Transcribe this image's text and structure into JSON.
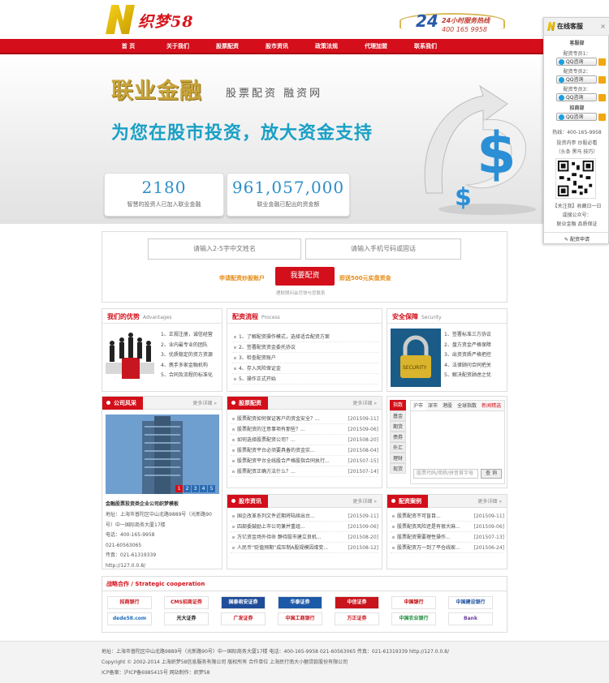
{
  "header": {
    "logo_text": "织梦58",
    "hotline_big": "24",
    "hotline_line1": "24小时服务热线",
    "hotline_line2": "400 165 9958"
  },
  "nav": [
    "首 页",
    "关于我们",
    "股票配资",
    "股市资讯",
    "政策法规",
    "代理加盟",
    "联系我们"
  ],
  "banner": {
    "brand": "联业金融",
    "tagline": "股票配资 融资网",
    "slogan": "为您在股市投资，放大资金支持",
    "stat1_num": "2180",
    "stat1_label": "智慧的投资人已加入联业金融",
    "stat2_num": "961,057,000",
    "stat2_label": "联业金融已配出的资金额"
  },
  "form": {
    "name_placeholder": "请输入2-5字中文姓名",
    "phone_placeholder": "请输入手机号码或固话",
    "left_text": "申请配资炒股账户",
    "button": "我要配资",
    "right_text": "即送500元实盘资金",
    "note": "理财顾问会尽快与您联系"
  },
  "advantages": {
    "title": "我们的优势",
    "en": "Advantages",
    "items": [
      "1、正规注册，诚信经营",
      "2、业内最专业的团队",
      "3、优质稳定的资方资源",
      "4、携手多家金融机构",
      "5、合同及流程的标准化"
    ]
  },
  "process": {
    "title": "配资流程",
    "en": "Process",
    "items": [
      "1、了解配资操作模式，选择适合配资方案",
      "2、签署配资资金委托协议",
      "3、检查配资账户",
      "4、存入风险保证金",
      "5、操作正式开始"
    ]
  },
  "security": {
    "title": "安全保障",
    "en": "Security",
    "items": [
      "1、签署标准三方协议",
      "2、盘方资金严格保障",
      "3、出资资质严格把控",
      "4、法律顾问合同把关",
      "5、解决配资顾虑之忧"
    ]
  },
  "company": {
    "title": "公司风采",
    "more": "更多详细 »",
    "pager": [
      "1",
      "2",
      "3",
      "4",
      "5"
    ],
    "name": "金融股票投资类企业公司织梦模板",
    "lines": [
      "地址：上海市普陀区中山北路9889号（光新路90",
      "号）中一国际商务大厦17楼",
      "电话：400-165-9958",
      "021-60563065",
      "传真：021-61319339",
      "http://127.0.0.8/"
    ]
  },
  "stock_finance": {
    "title": "股票配资",
    "more": "更多详细 »",
    "items": [
      {
        "t": "股票配资如何保证客户的资金安全？...",
        "d": "[201509-11]"
      },
      {
        "t": "股票配资的注意事项有那些？...",
        "d": "[201509-06]"
      },
      {
        "t": "如何选择股票配资公司？...",
        "d": "[201508-20]"
      },
      {
        "t": "股票配资平台必须要具备的资金实...",
        "d": "[201508-04]"
      },
      {
        "t": "股票配资平台全线股合严格股指合同执行...",
        "d": "[201507-15]"
      },
      {
        "t": "股票配资正确方法什么？...",
        "d": "[201507-14]"
      }
    ]
  },
  "market": {
    "tabs_left": [
      "指数",
      "基金",
      "期货",
      "债券",
      "外汇",
      "理财",
      "现货"
    ],
    "tabs_top": [
      "沪市",
      "深市",
      "港股",
      "全球指数",
      "新闻精选"
    ],
    "search_placeholder": "股票代码/简称/拼音首字母",
    "search_button": "查 询"
  },
  "news": {
    "title": "股市资讯",
    "more": "更多详细 »",
    "items": [
      {
        "t": "国企改革系列文件近期将陆续出台...",
        "d": "[201509-11]"
      },
      {
        "t": "四部委鼓励上市公司兼并重组...",
        "d": "[201509-06]"
      },
      {
        "t": "万亿资金场外待命 静待股市建立良机...",
        "d": "[201508-20]"
      },
      {
        "t": "人民币“贬值预期”成压制A股规模因缘变...",
        "d": "[201508-12]"
      }
    ]
  },
  "cases": {
    "title": "配资案例",
    "more": "更多详细 »",
    "items": [
      {
        "t": "股票配资不可盲目...",
        "d": "[201509-11]"
      },
      {
        "t": "股票配资风险还是有很大麻...",
        "d": "[201509-06]"
      },
      {
        "t": "股票配资需要理性操作...",
        "d": "[201507-13]"
      },
      {
        "t": "股票配资万一到了平仓线家...",
        "d": "[201506-24]"
      }
    ]
  },
  "partners": {
    "title": "战略合作 / Strategic cooperation",
    "row1": [
      "招商银行",
      "CMS招商证券",
      "国泰君安证券",
      "华泰证券",
      "中信证券",
      "中国银行",
      "中国建设银行"
    ],
    "row2": [
      "dede58.com",
      "光大证券",
      "广发证券",
      "中国工商银行",
      "万正证券",
      "中国农业银行",
      "Bank"
    ]
  },
  "footer": {
    "l1": "地址：上海市普陀区中山北路9889号（光新路90号）中一国际商务大厦17楼    电话：400-165-9958   021-60563065    传真：021-61319339    http://127.0.0.8/",
    "l2": "Copyright © 2002-2014 上海织梦58信息服务有限公司 版权所有 合作单位 上海民行南大小额贷款股份有限公司",
    "l3": "ICP备案：沪ICP备6985415号 网站制作：织梦58"
  },
  "sidebar": {
    "title": "在线客服",
    "dept1": "客服部",
    "spec1": "配资专员1：",
    "spec2": "配资专员2：",
    "spec3": "配资专员3：",
    "dept2": "招商部",
    "qq": "QQ咨询",
    "hotline": "热线：400-165-9958",
    "t1": "投资内参 炒股必看",
    "t2": "（头条 黑马 技巧）",
    "t3": "【关注我】收藏日一日",
    "t4": "或搜公众号：",
    "t5": "联业金融 品质保证",
    "apply": "配资申请"
  },
  "colors": {
    "brand_red": "#d40f1b",
    "accent_blue": "#2d8fc9",
    "gold": "#c8a43b"
  }
}
